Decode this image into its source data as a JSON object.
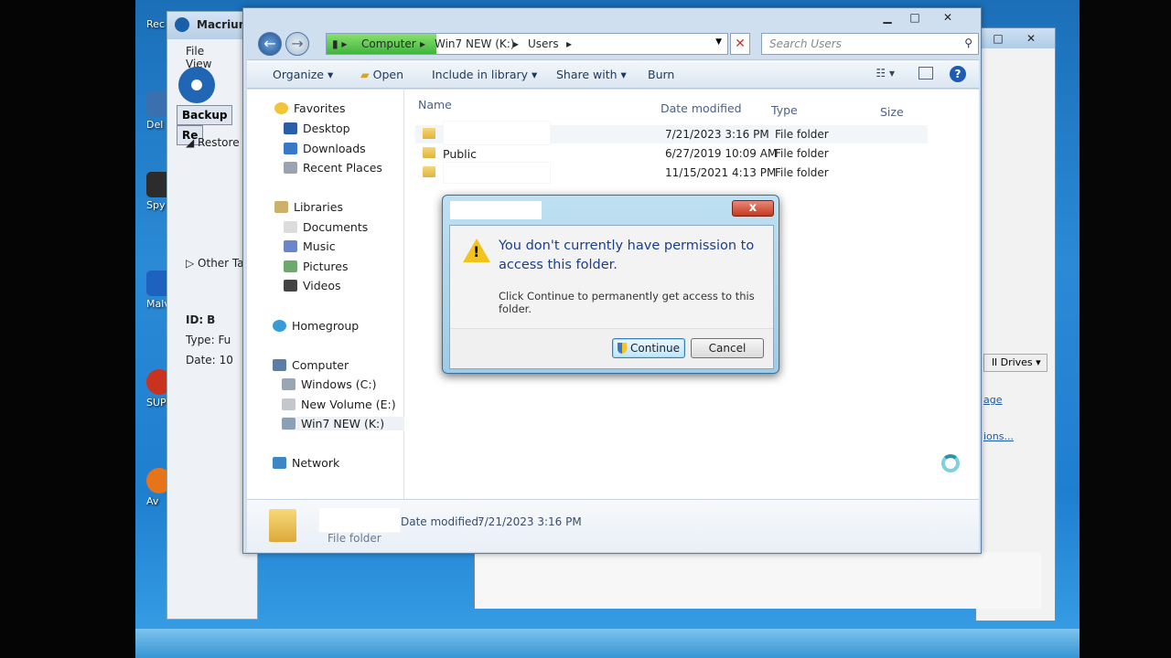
{
  "desktop": {
    "icons": [
      {
        "label": "Rec",
        "name": "desktop-icon-recycle"
      },
      {
        "label": "Del",
        "name": "desktop-icon-del"
      },
      {
        "label": "Spy",
        "name": "desktop-icon-spy"
      },
      {
        "label": "Malv",
        "name": "desktop-icon-malv"
      },
      {
        "label": "SUP",
        "name": "desktop-icon-sup"
      },
      {
        "label": "Av",
        "name": "desktop-icon-av"
      }
    ]
  },
  "macrium": {
    "title": "Macrium",
    "menu": [
      "File",
      "View"
    ],
    "tabs": [
      "Backup",
      "Re"
    ],
    "restore_label": "Restore",
    "other_tasks": "Other Ta",
    "id_label": "ID:",
    "id_value": "B",
    "type_label": "Type:",
    "type_value": "Fu",
    "date_label": "Date:",
    "date_value": "10"
  },
  "rightwin": {
    "drives": "ll Drives",
    "link1": "age",
    "link2": "ions..."
  },
  "explorer": {
    "breadcrumb": [
      "Computer",
      "Win7 NEW (K:)",
      "Users"
    ],
    "search_placeholder": "Search Users",
    "commands": {
      "organize": "Organize",
      "open": "Open",
      "include": "Include in library",
      "share": "Share with",
      "burn": "Burn"
    },
    "nav": {
      "favorites": "Favorites",
      "desktop": "Desktop",
      "downloads": "Downloads",
      "recent": "Recent Places",
      "libraries": "Libraries",
      "documents": "Documents",
      "music": "Music",
      "pictures": "Pictures",
      "videos": "Videos",
      "homegroup": "Homegroup",
      "computer": "Computer",
      "windows_c": "Windows (C:)",
      "new_volume": "New Volume (E:)",
      "win7new": "Win7 NEW (K:)",
      "network": "Network"
    },
    "columns": {
      "name": "Name",
      "date": "Date modified",
      "type": "Type",
      "size": "Size"
    },
    "files": [
      {
        "name": "",
        "date": "7/21/2023 3:16 PM",
        "type": "File folder"
      },
      {
        "name": "Public",
        "date": "6/27/2019 10:09 AM",
        "type": "File folder"
      },
      {
        "name": "",
        "date": "11/15/2021 4:13 PM",
        "type": "File folder"
      }
    ],
    "details": {
      "date_label": "Date modified:",
      "date_value": "7/21/2023 3:16 PM",
      "type": "File folder"
    }
  },
  "dialog": {
    "close_glyph": "x",
    "warn_glyph": "!",
    "main_text": "You don't currently have permission to access this folder.",
    "sub_text": "Click Continue to permanently get access to this folder.",
    "continue_label": "Continue",
    "cancel_label": "Cancel"
  },
  "colors": {
    "desktop_blue": "#2a8ad6",
    "dialog_heading": "#1a3e8a",
    "warning_yellow": "#f2c31c",
    "close_red": "#c4391f"
  }
}
